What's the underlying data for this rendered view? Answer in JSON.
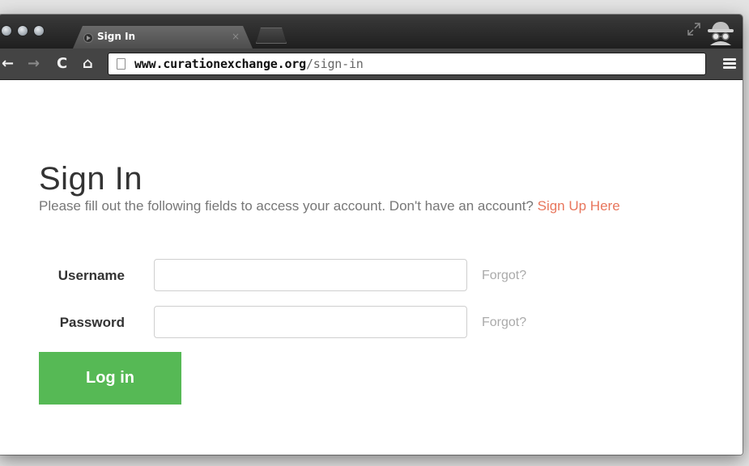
{
  "browser": {
    "tab": {
      "title": "Sign In",
      "close_glyph": "×"
    },
    "nav": {
      "back_glyph": "←",
      "forward_glyph": "→",
      "reload_glyph": "C",
      "home_glyph": "⌂"
    },
    "url": {
      "host": "www.curationexchange.org",
      "path": "/sign-in"
    },
    "icons": [
      "back-icon",
      "forward-icon",
      "reload-icon",
      "home-icon",
      "page-icon",
      "menu-icon",
      "incognito-icon",
      "fullscreen-icon",
      "favicon-icon"
    ]
  },
  "page": {
    "title": "Sign In",
    "intro_text": "Please fill out the following fields to access your account. Don't have an account? ",
    "signup_link": "Sign Up Here",
    "form": {
      "username_label": "Username",
      "username_value": "",
      "password_label": "Password",
      "password_value": "",
      "forgot_username": "Forgot?",
      "forgot_password": "Forgot?",
      "submit_label": "Log in"
    }
  },
  "colors": {
    "accent_link": "#e8765c",
    "button_green": "#56b955",
    "muted_text": "#aaaaaa"
  }
}
